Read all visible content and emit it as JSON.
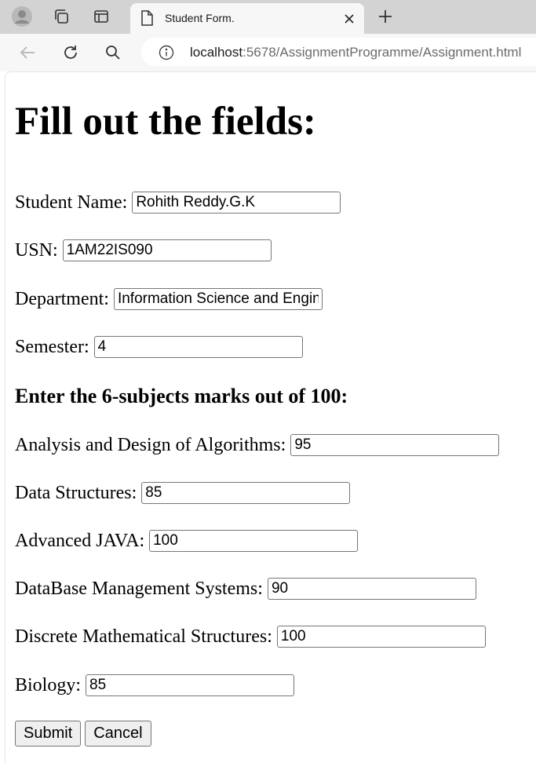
{
  "browser": {
    "tab_title": "Student Form.",
    "url_host": "localhost",
    "url_path": ":5678/AssignmentProgramme/Assignment.html"
  },
  "page": {
    "heading": "Fill out the fields:",
    "subheading": "Enter the 6-subjects marks out of 100:"
  },
  "student": {
    "name_label": "Student Name:",
    "name_value": "Rohith Reddy.G.K",
    "usn_label": "USN:",
    "usn_value": "1AM22IS090",
    "department_label": "Department:",
    "department_value": "Information Science and Engineering",
    "semester_label": "Semester:",
    "semester_value": "4"
  },
  "marks": [
    {
      "label": "Analysis and Design of Algorithms:",
      "value": "95"
    },
    {
      "label": "Data Structures:",
      "value": "85"
    },
    {
      "label": "Advanced JAVA:",
      "value": "100"
    },
    {
      "label": "DataBase Management Systems:",
      "value": "90"
    },
    {
      "label": "Discrete Mathematical Structures:",
      "value": "100"
    },
    {
      "label": "Biology:",
      "value": "85"
    }
  ],
  "buttons": {
    "submit": "Submit",
    "cancel": "Cancel"
  },
  "icons": [
    "profile-icon",
    "collections-icon",
    "tab-actions-icon",
    "document-icon",
    "close-icon",
    "new-tab-icon",
    "back-icon",
    "refresh-icon",
    "search-icon",
    "info-icon"
  ]
}
